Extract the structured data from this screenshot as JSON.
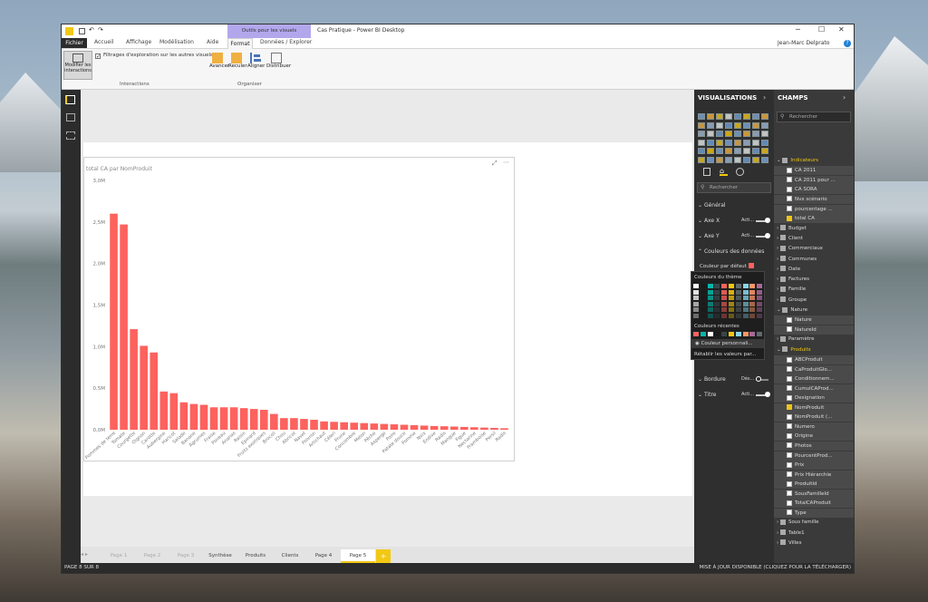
{
  "window": {
    "title": "Cas Pratique - Power BI Desktop",
    "user": "Jean-Marc Delprato",
    "context_tab": "Outils pour les visuels"
  },
  "ribbon_tabs": [
    "Fichier",
    "Accueil",
    "Affichage",
    "Modélisation",
    "Aide",
    "Format",
    "Données / Explorer"
  ],
  "ribbon": {
    "modify_btn": "Modifier les interactions",
    "filter_check": "Filtrages d'exploration sur les autres visuels",
    "group_interactions": "Interactions",
    "advance": "Avancer",
    "back": "Reculer",
    "align": "Aligner",
    "distribute": "Distribuer",
    "group_arrange": "Organiser"
  },
  "chart_data": {
    "type": "bar",
    "title": "total CA par NomProduit",
    "ylim": [
      0,
      3000000
    ],
    "yticks": [
      "0,0M",
      "0,5M",
      "1,0M",
      "1,5M",
      "2,0M",
      "2,5M",
      "3,0M"
    ],
    "categories": [
      "Pommes de terre",
      "Tomate",
      "Courgette",
      "Oignon",
      "Carotte",
      "Aubergine",
      "Haricot",
      "Salade",
      "Banane",
      "Agrumes",
      "Fraise",
      "Poireau",
      "Brocoli",
      "Ananas",
      "Raisin",
      "Epinard",
      "Fruits exotiques",
      "Chou",
      "Abricot",
      "Navet",
      "Poivron",
      "Artichaut",
      "Céleri",
      "Prune",
      "Concombre",
      "Melon",
      "Pêche",
      "Asperge",
      "Poire",
      "Cerise",
      "Patate douce",
      "Noix",
      "Endive",
      "Pomme",
      "Radis",
      "Mangue",
      "Figue",
      "Nectarine",
      "Framboise",
      "Persil"
    ],
    "values": [
      2600000,
      2470000,
      1210000,
      1010000,
      930000,
      460000,
      440000,
      330000,
      310000,
      300000,
      270000,
      270000,
      270000,
      260000,
      250000,
      240000,
      190000,
      140000,
      140000,
      130000,
      120000,
      100000,
      95000,
      90000,
      85000,
      80000,
      75000,
      70000,
      65000,
      60000,
      55000,
      50000,
      45000,
      42000,
      38000,
      34000,
      30000,
      26000,
      22000,
      18000
    ],
    "xlabels": [
      "Pommes de terre",
      "Tomate",
      "Courgette",
      "Oignon",
      "Carotte",
      "Aubergine",
      "Haricot",
      "Salade",
      "Banane",
      "Agrumes",
      "Fraise",
      "Poireau",
      "Ananas",
      "Raisin",
      "Epinard",
      "Fruits exotiques",
      "Brocoli",
      "Chou",
      "Abricot",
      "Navet",
      "Poivron",
      "Artichaut",
      "Céleri",
      "Prune",
      "Concombre",
      "Melon",
      "Pêche",
      "Asperge",
      "Poire",
      "Patate douce",
      "Pomme",
      "Noix",
      "Endive",
      "Radis",
      "Mangue",
      "Figue",
      "Nectarine",
      "Framboise",
      "Persil",
      "Radis"
    ],
    "bar_color": "#fd625e"
  },
  "page_tabs": [
    "Page 1",
    "Page 2",
    "Page 3",
    "Synthèse",
    "Produits",
    "Clients",
    "Page 4",
    "Page 5",
    "+"
  ],
  "status": {
    "left": "PAGE 8 SUR 8",
    "right": "MISE À JOUR DISPONIBLE (CLIQUEZ POUR LA TÉLÉCHARGER)"
  },
  "viz": {
    "header": "VISUALISATIONS",
    "search": "Rechercher",
    "sections": [
      "Général",
      "Axe X",
      "Axe Y",
      "Couleurs des données"
    ],
    "axis_x_toggle": "Acti...",
    "axis_y_toggle": "Acti...",
    "default_color": "Couleur par défaut",
    "theme_colors": "Couleurs du thème",
    "recent_colors": "Couleurs récentes",
    "custom_color": "Couleur personnali...",
    "reset": "Rétablir les valeurs par...",
    "border": "Bordure",
    "border_toggle": "Dés...",
    "title": "Titre",
    "title_toggle": "Acti..."
  },
  "fields": {
    "header": "CHAMPS",
    "search": "Rechercher",
    "tables": [
      {
        "name": "Indicateurs",
        "open": true,
        "items": [
          {
            "name": "CA 2011",
            "checked": false
          },
          {
            "name": "CA 2011 pour ...",
            "checked": false
          },
          {
            "name": "CA SORA",
            "checked": false
          },
          {
            "name": "Nvx scénario",
            "checked": false
          },
          {
            "name": "pourcentage ...",
            "checked": false
          },
          {
            "name": "total CA",
            "checked": true
          }
        ]
      },
      {
        "name": "Budget"
      },
      {
        "name": "Client"
      },
      {
        "name": "Commerciaux"
      },
      {
        "name": "Communes"
      },
      {
        "name": "Date"
      },
      {
        "name": "Factures"
      },
      {
        "name": "Famille"
      },
      {
        "name": "Groupe"
      },
      {
        "name": "Nature",
        "open": true,
        "items": [
          {
            "name": "Nature",
            "checked": false
          },
          {
            "name": "NatureId",
            "checked": false
          }
        ]
      },
      {
        "name": "Paramètre"
      },
      {
        "name": "Produits",
        "open": true,
        "items": [
          {
            "name": "ABCProduit",
            "checked": false
          },
          {
            "name": "CaProduitGlo...",
            "checked": false
          },
          {
            "name": "Conditionnem...",
            "checked": false
          },
          {
            "name": "CumulCAProd...",
            "checked": false
          },
          {
            "name": "Designation",
            "checked": false
          },
          {
            "name": "NomProduit",
            "checked": true
          },
          {
            "name": "NomProduit (...",
            "checked": false
          },
          {
            "name": "Numero",
            "checked": false
          },
          {
            "name": "Origine",
            "checked": false
          },
          {
            "name": "Photos",
            "checked": false
          },
          {
            "name": "PourcentProd...",
            "checked": false
          },
          {
            "name": "Prix",
            "checked": false
          },
          {
            "name": "Prix Hiérarchie",
            "checked": false
          },
          {
            "name": "ProduitId",
            "checked": false
          },
          {
            "name": "SousFamilleId",
            "checked": false
          },
          {
            "name": "TotalCAProduit",
            "checked": false
          },
          {
            "name": "Type",
            "checked": false
          }
        ]
      },
      {
        "name": "Sous famille"
      },
      {
        "name": "Table1"
      },
      {
        "name": "Villes"
      }
    ]
  }
}
